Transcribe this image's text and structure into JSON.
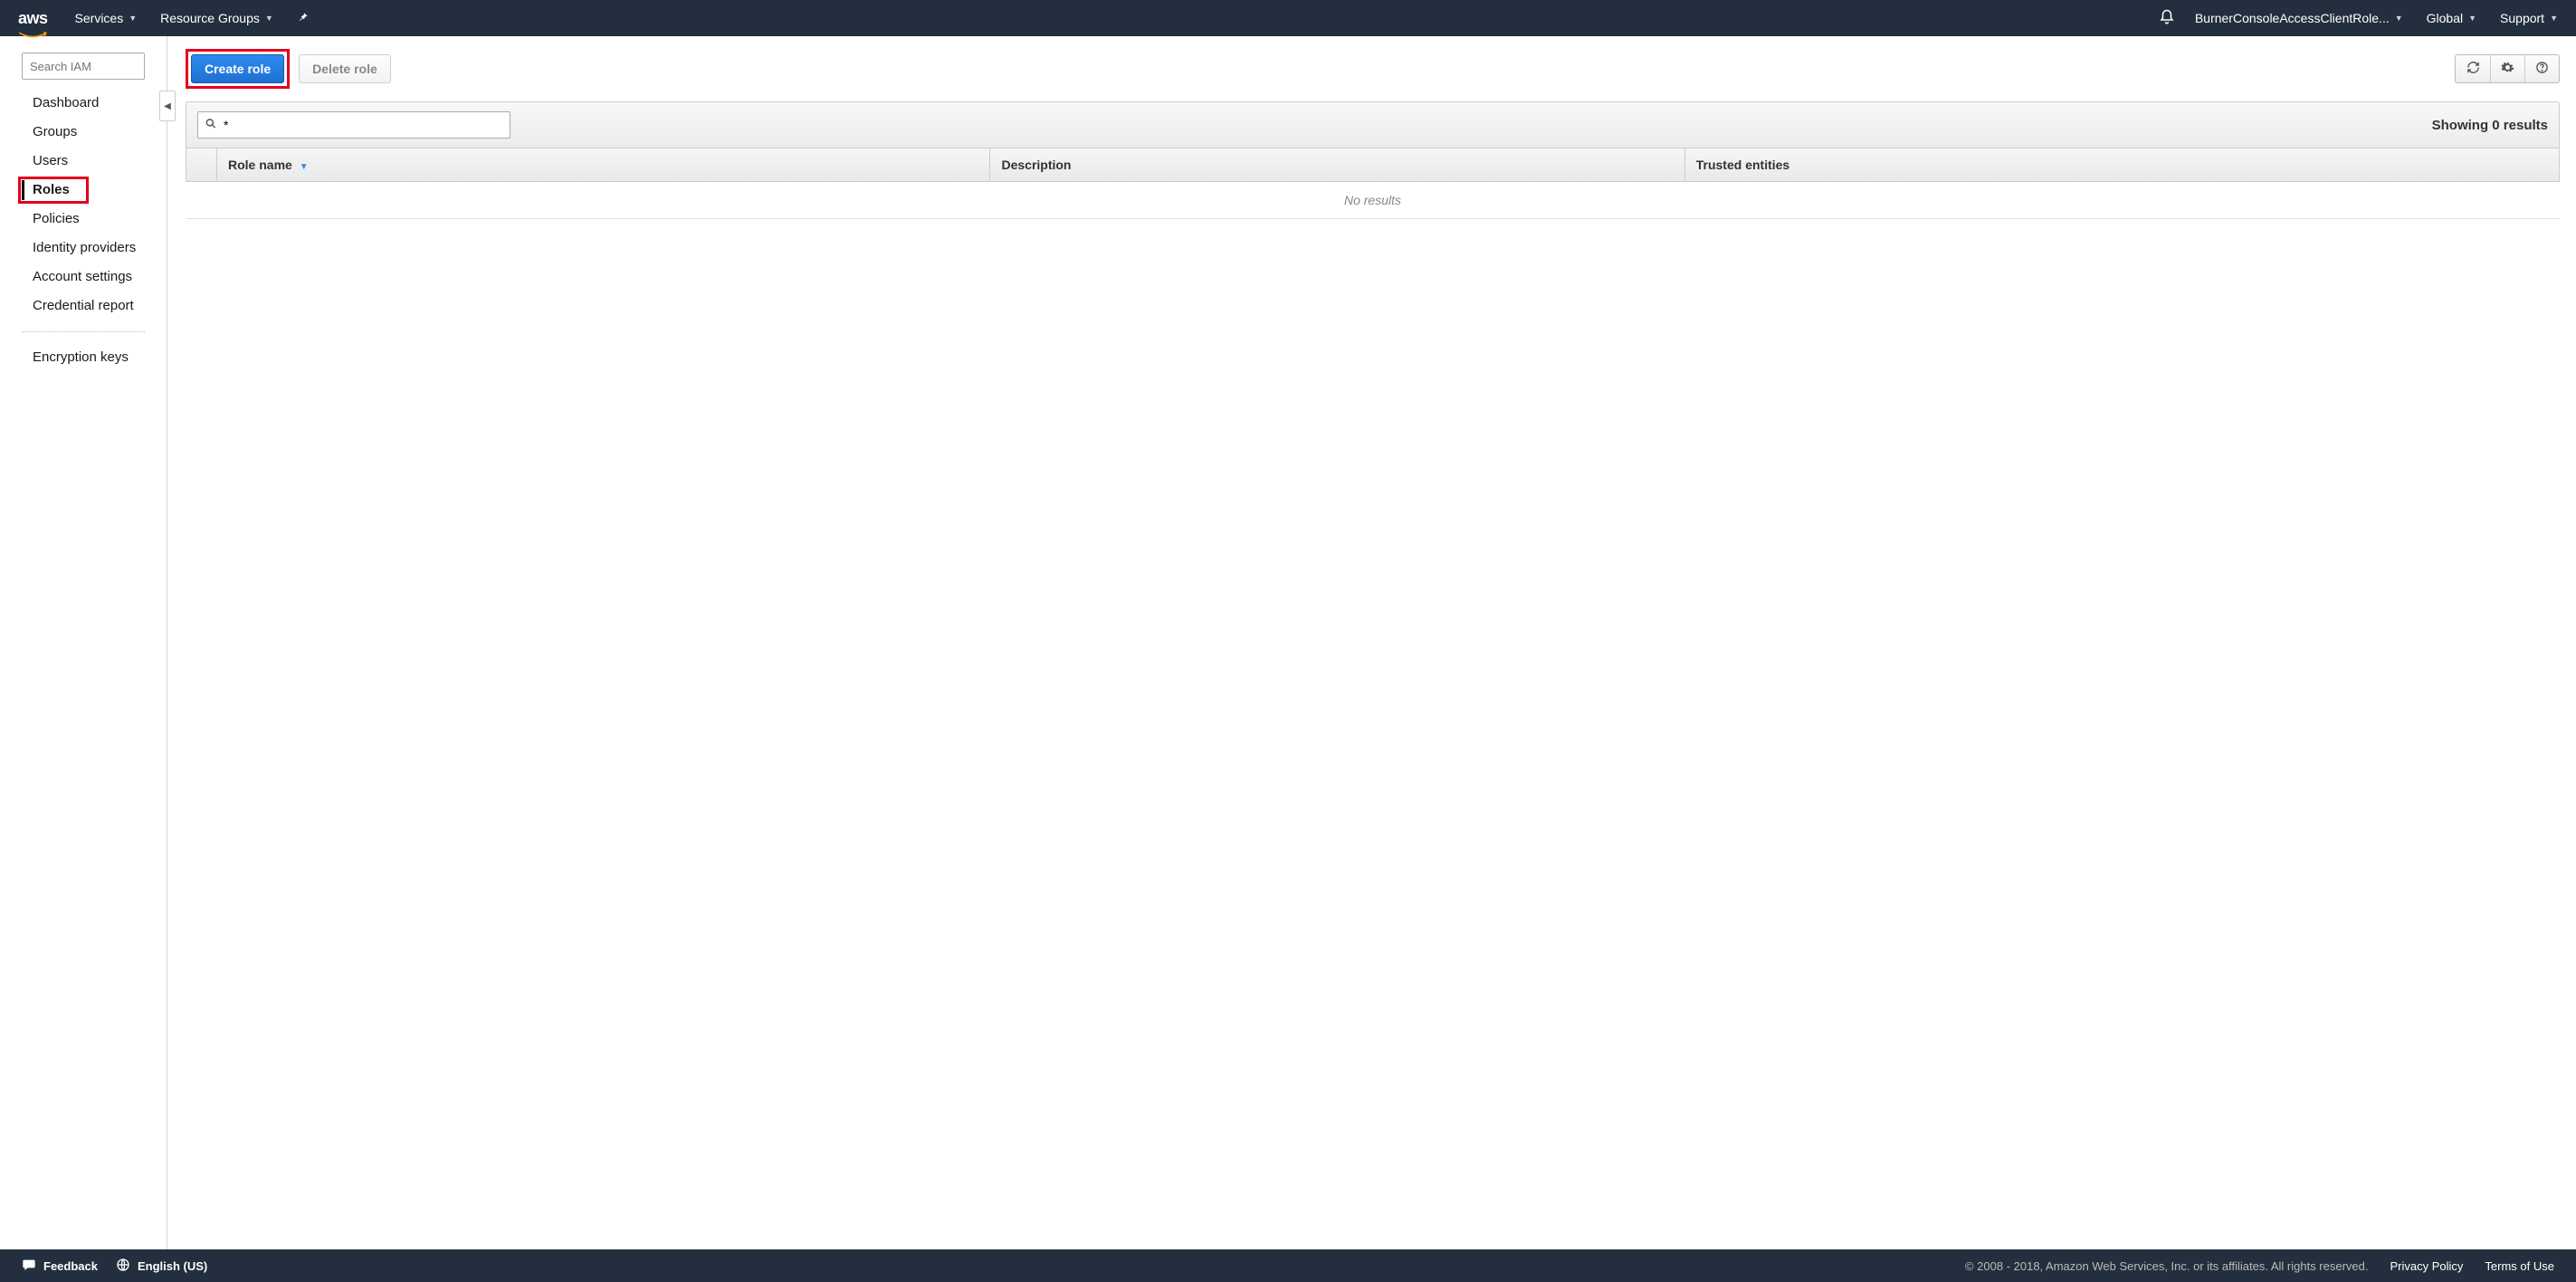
{
  "topnav": {
    "logo_text": "aws",
    "services": "Services",
    "resource_groups": "Resource Groups",
    "account": "BurnerConsoleAccessClientRole...",
    "region": "Global",
    "support": "Support"
  },
  "sidebar": {
    "search_placeholder": "Search IAM",
    "items": [
      {
        "label": "Dashboard",
        "active": false
      },
      {
        "label": "Groups",
        "active": false
      },
      {
        "label": "Users",
        "active": false
      },
      {
        "label": "Roles",
        "active": true
      },
      {
        "label": "Policies",
        "active": false
      },
      {
        "label": "Identity providers",
        "active": false
      },
      {
        "label": "Account settings",
        "active": false
      },
      {
        "label": "Credential report",
        "active": false
      }
    ],
    "extra": [
      {
        "label": "Encryption keys"
      }
    ]
  },
  "toolbar": {
    "create_role": "Create role",
    "delete_role": "Delete role"
  },
  "filter": {
    "value": "*",
    "results_text": "Showing 0 results"
  },
  "table": {
    "headers": {
      "role_name": "Role name",
      "description": "Description",
      "trusted_entities": "Trusted entities"
    },
    "no_results": "No results"
  },
  "footer": {
    "feedback": "Feedback",
    "language": "English (US)",
    "copyright": "© 2008 - 2018, Amazon Web Services, Inc. or its affiliates. All rights reserved.",
    "privacy": "Privacy Policy",
    "terms": "Terms of Use"
  }
}
